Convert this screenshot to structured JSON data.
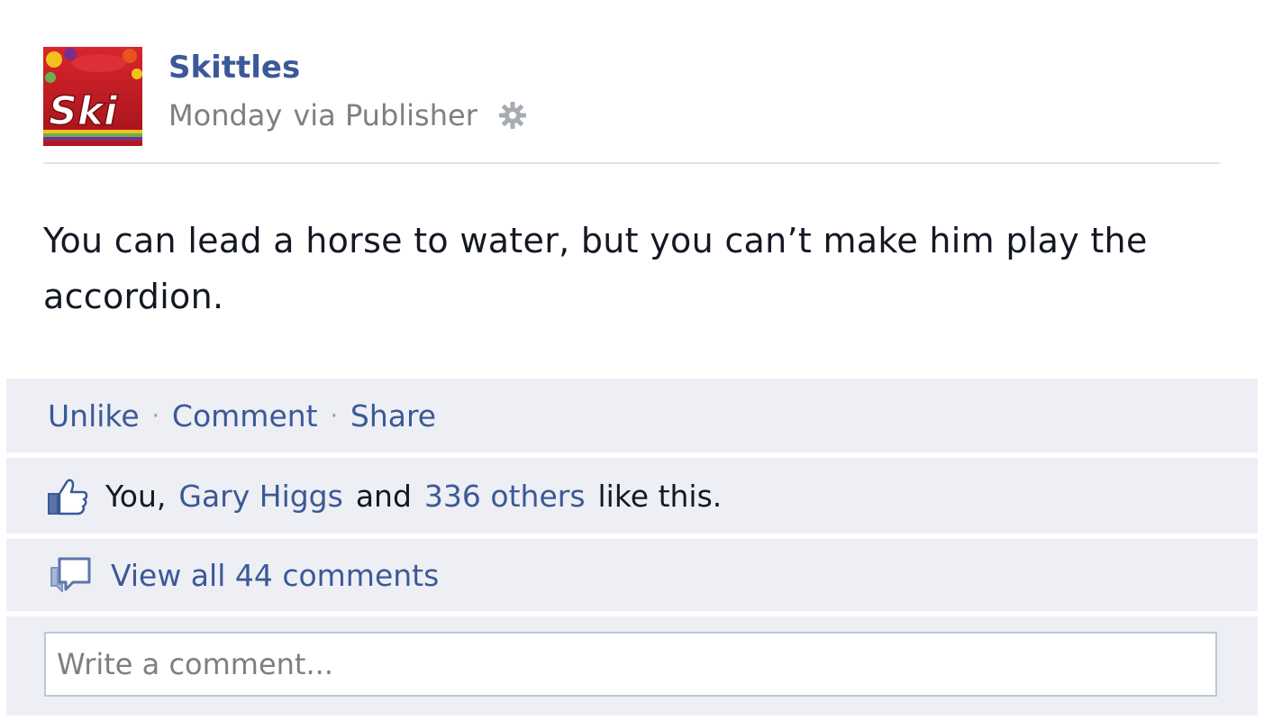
{
  "post": {
    "page_name": "Skittles",
    "timestamp": "Monday",
    "via_text": "via Publisher",
    "message": "You can lead a horse to water, but you can’t make him play the accordion.",
    "avatar_text": "Ski",
    "audience_icon": "gear-icon"
  },
  "actions": {
    "unlike": "Unlike",
    "comment": "Comment",
    "share": "Share",
    "separator": "·"
  },
  "likes": {
    "icon": "thumbs-up-icon",
    "you": "You,",
    "friend": "Gary Higgs",
    "and": "and",
    "others": "336 others",
    "suffix": "like this."
  },
  "comments": {
    "icon": "comment-bubble-icon",
    "view_all": "View all 44 comments"
  },
  "comment_box": {
    "placeholder": "Write a comment...",
    "value": ""
  },
  "colors": {
    "link": "#3b5998",
    "ufi_background": "#edeff4",
    "meta_text": "#7f7f7f",
    "body_text": "#141823",
    "brand_red": "#c01a22"
  }
}
